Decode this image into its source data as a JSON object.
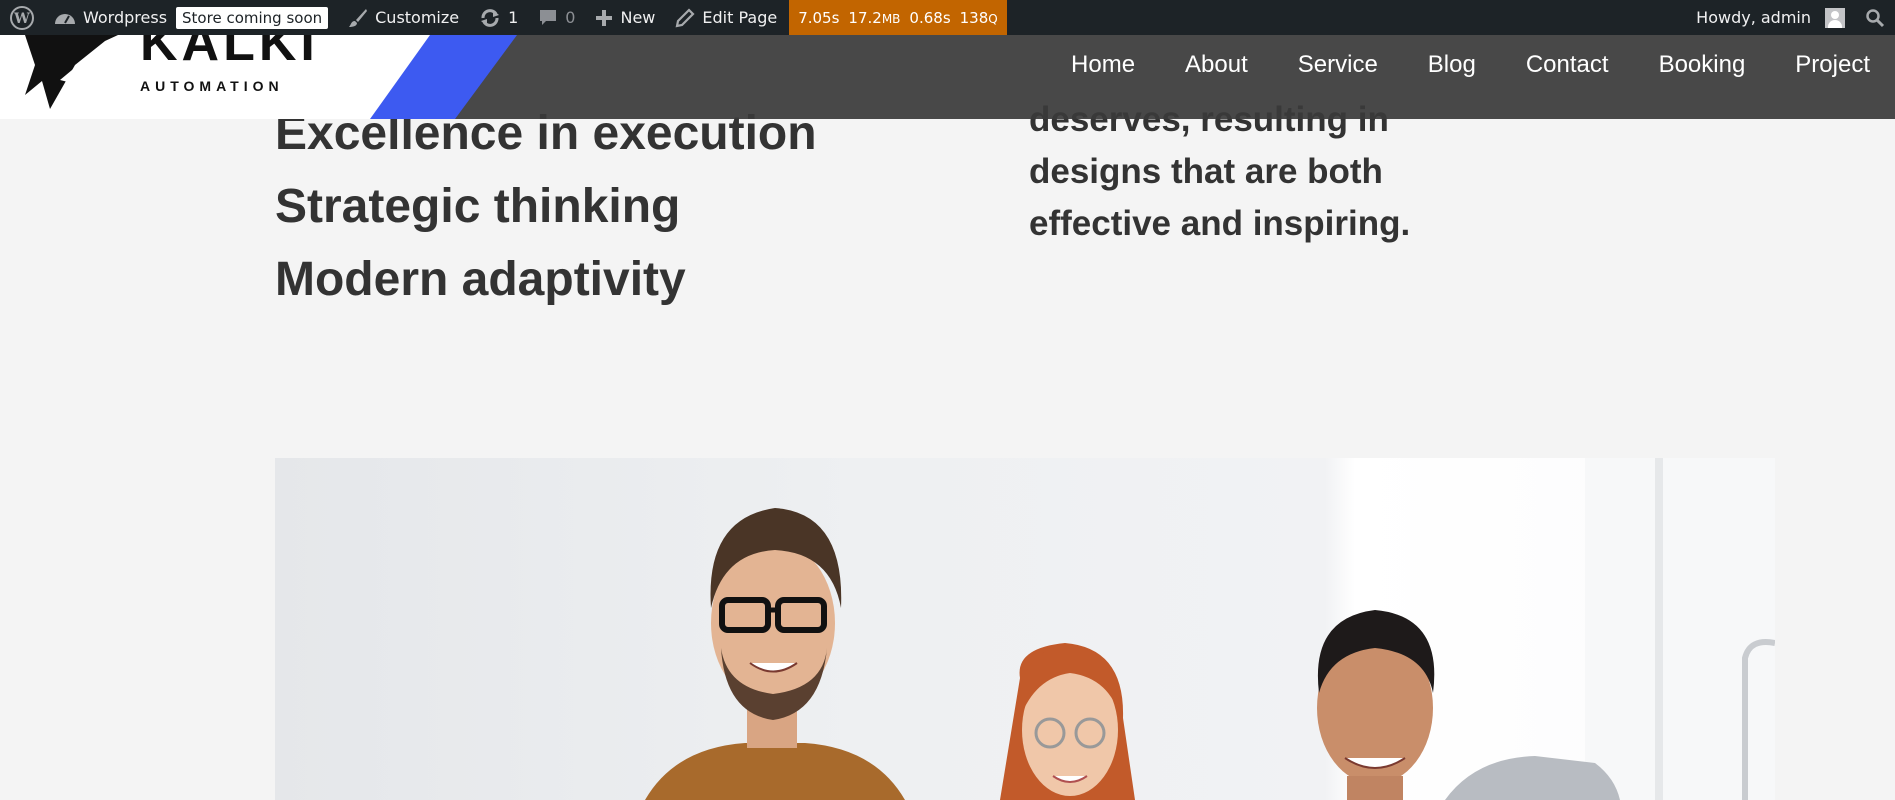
{
  "adminbar": {
    "site_name": "Wordpress",
    "store_badge": "Store coming soon",
    "customize": "Customize",
    "updates_count": "1",
    "comments_count": "0",
    "new": "New",
    "edit_page": "Edit Page",
    "qm": {
      "time": "7.05s",
      "memory": "17.2",
      "memory_unit": "MB",
      "db_time": "0.68s",
      "queries": "138",
      "queries_unit": "Q"
    },
    "howdy": "Howdy, admin",
    "qm_color": "#c26500"
  },
  "header": {
    "logo_word": "KALKI",
    "logo_sub": "AUTOMATION",
    "nav": [
      "Home",
      "About",
      "Service",
      "Blog",
      "Contact",
      "Booking",
      "Project"
    ],
    "accent_color": "#3d5af1"
  },
  "content": {
    "left_lines": [
      "Excellence in execution",
      "Strategic thinking",
      "Modern adaptivity"
    ],
    "right_lines": [
      "deserves, resulting in",
      "designs that are both",
      "effective and inspiring."
    ]
  },
  "icons": [
    "wordpress-logo-icon",
    "dashboard-icon",
    "brush-icon",
    "update-icon",
    "comment-icon",
    "plus-icon",
    "pencil-icon",
    "search-icon"
  ]
}
